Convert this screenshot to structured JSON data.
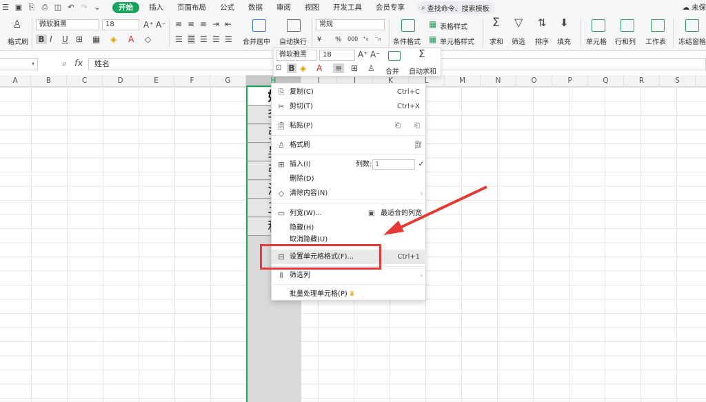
{
  "menubar": {
    "menus": [
      "开始",
      "插入",
      "页面布局",
      "公式",
      "数据",
      "审阅",
      "视图",
      "开发工具",
      "会员专享"
    ],
    "active_menu": "开始",
    "search_placeholder": "查找命令、搜索模板",
    "cloud_status": "未保"
  },
  "ribbon": {
    "format_painter": "格式刷",
    "font_name": "微软雅黑",
    "font_size": "18",
    "merge_center": "合并居中",
    "auto_wrap": "自动换行",
    "number_format": "常规",
    "conditional_format": "条件格式",
    "table_style": "表格样式",
    "cell_style": "单元格样式",
    "sum": "求和",
    "filter": "筛选",
    "sort": "排序",
    "fill": "填充",
    "cell": "单元格",
    "row_col": "行和列",
    "worksheet": "工作表",
    "freeze": "冻结窗格",
    "percent_symbol": "%",
    "thousands": "000",
    "currency": "¥"
  },
  "formula_bar": {
    "fx_label": "fx",
    "content": "姓名"
  },
  "columns": [
    "A",
    "B",
    "C",
    "D",
    "E",
    "F",
    "G",
    "H",
    "I",
    "J",
    "K",
    "L",
    "M",
    "N",
    "O",
    "P",
    "Q",
    "R",
    "S"
  ],
  "column_h_cells": [
    "姓",
    "李",
    "张",
    "吴",
    "张",
    "潘",
    "王",
    "程"
  ],
  "mini_toolbar": {
    "font_name": "微软雅黑",
    "font_size": "18",
    "merge": "合并",
    "auto_sum": "自动求和"
  },
  "context_menu": {
    "copy": "复制(C)",
    "copy_shortcut": "Ctrl+C",
    "cut": "剪切(T)",
    "cut_shortcut": "Ctrl+X",
    "paste": "粘贴(P)",
    "format_painter": "格式刷",
    "insert": "插入(I)",
    "column_count_label": "列数:",
    "column_count": "1",
    "delete": "删除(D)",
    "clear": "清除内容(N)",
    "col_width": "列宽(W)...",
    "best_fit": "最适合的列宽",
    "hide": "隐藏(H)",
    "unhide": "取消隐藏(U)",
    "format_cells": "设置单元格格式(F)...",
    "format_cells_shortcut": "Ctrl+1",
    "filter_col": "筛选列",
    "batch": "批量处理单元格(P)"
  }
}
